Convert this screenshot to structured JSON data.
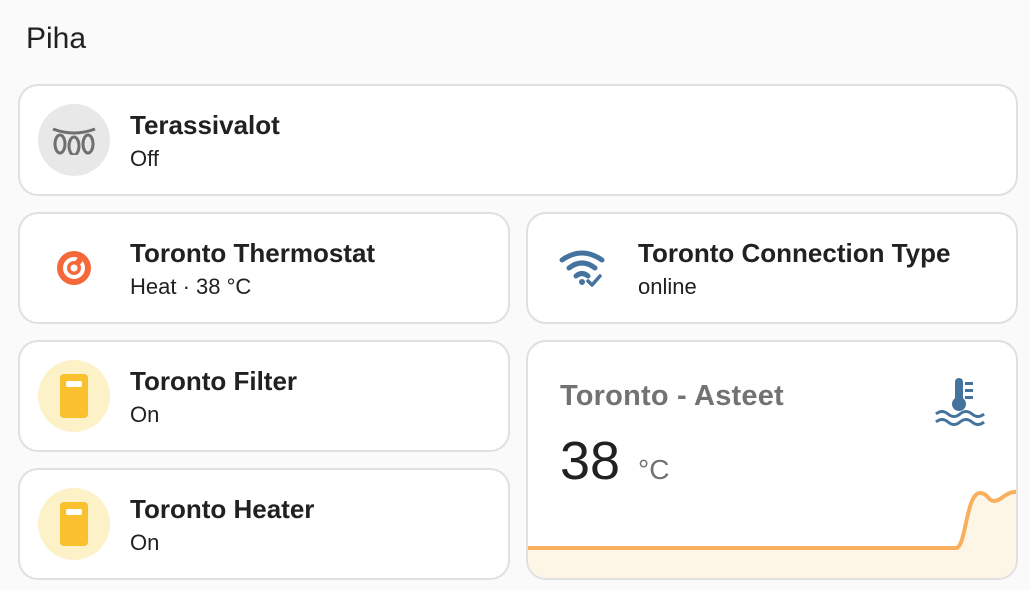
{
  "section": {
    "title": "Piha"
  },
  "tiles": [
    {
      "name": "Terassivalot",
      "state": "Off",
      "icon": "string-lights-icon"
    },
    {
      "name": "Toronto Thermostat",
      "state": "Heat · 38 °C",
      "icon": "thermostat-icon"
    },
    {
      "name": "Toronto Connection Type",
      "state": "online",
      "icon": "wifi-check-icon"
    },
    {
      "name": "Toronto Filter",
      "state": "On",
      "icon": "switch-icon"
    },
    {
      "name": "Toronto Heater",
      "state": "On",
      "icon": "switch-icon"
    }
  ],
  "sensor": {
    "name": "Toronto - Asteet",
    "value": "38",
    "unit": "°C",
    "icon": "water-thermometer-icon"
  },
  "colors": {
    "thermostat": "#f4683a",
    "wifi": "#44739e",
    "switch_on": "#fbc02d",
    "graph_line": "#f7b15e",
    "graph_fill": "#fdf5e6"
  }
}
